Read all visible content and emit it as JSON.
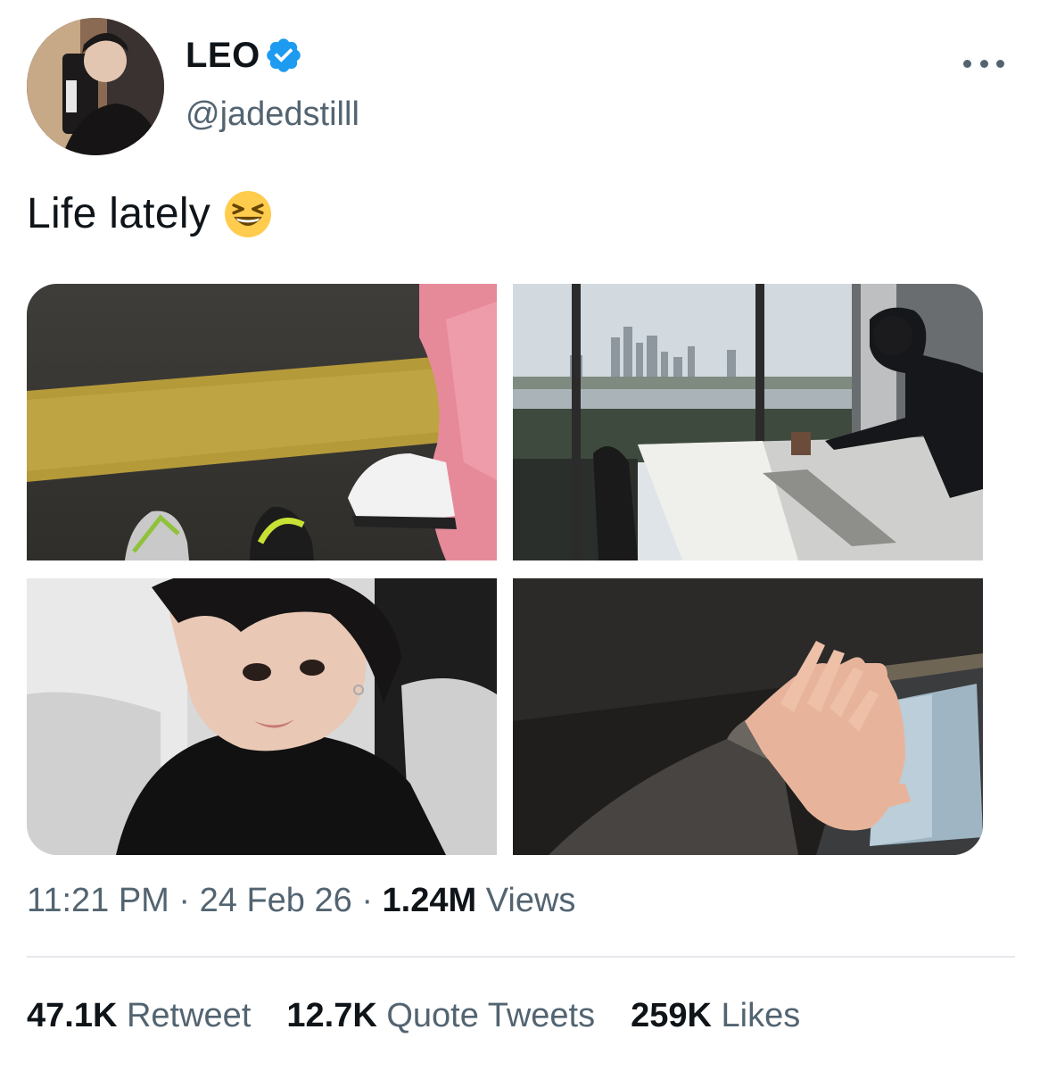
{
  "user": {
    "display_name": "LEO",
    "handle": "@jadedstilll",
    "verified": true,
    "verified_color": "#1d9bf0",
    "avatar_icon": "profile-photo"
  },
  "tweet": {
    "text": "Life lately",
    "emoji": "grinning-squinting-face"
  },
  "media": [
    {
      "name": "photo-sneakers-road",
      "description_icon": "photo"
    },
    {
      "name": "photo-office-window-view",
      "description_icon": "photo"
    },
    {
      "name": "photo-selfie",
      "description_icon": "photo"
    },
    {
      "name": "photo-hand-shadow",
      "description_icon": "photo"
    }
  ],
  "meta": {
    "time": "11:21 PM",
    "separator": "·",
    "date": "24 Feb 26",
    "views_count": "1.24M",
    "views_label": "Views"
  },
  "stats": {
    "retweets_count": "47.1K",
    "retweets_label": "Retweet",
    "quotes_count": "12.7K",
    "quotes_label": "Quote Tweets",
    "likes_count": "259K",
    "likes_label": "Likes"
  },
  "colors": {
    "text_primary": "#0f1419",
    "text_secondary": "#536471",
    "divider": "#e6e9ec"
  }
}
